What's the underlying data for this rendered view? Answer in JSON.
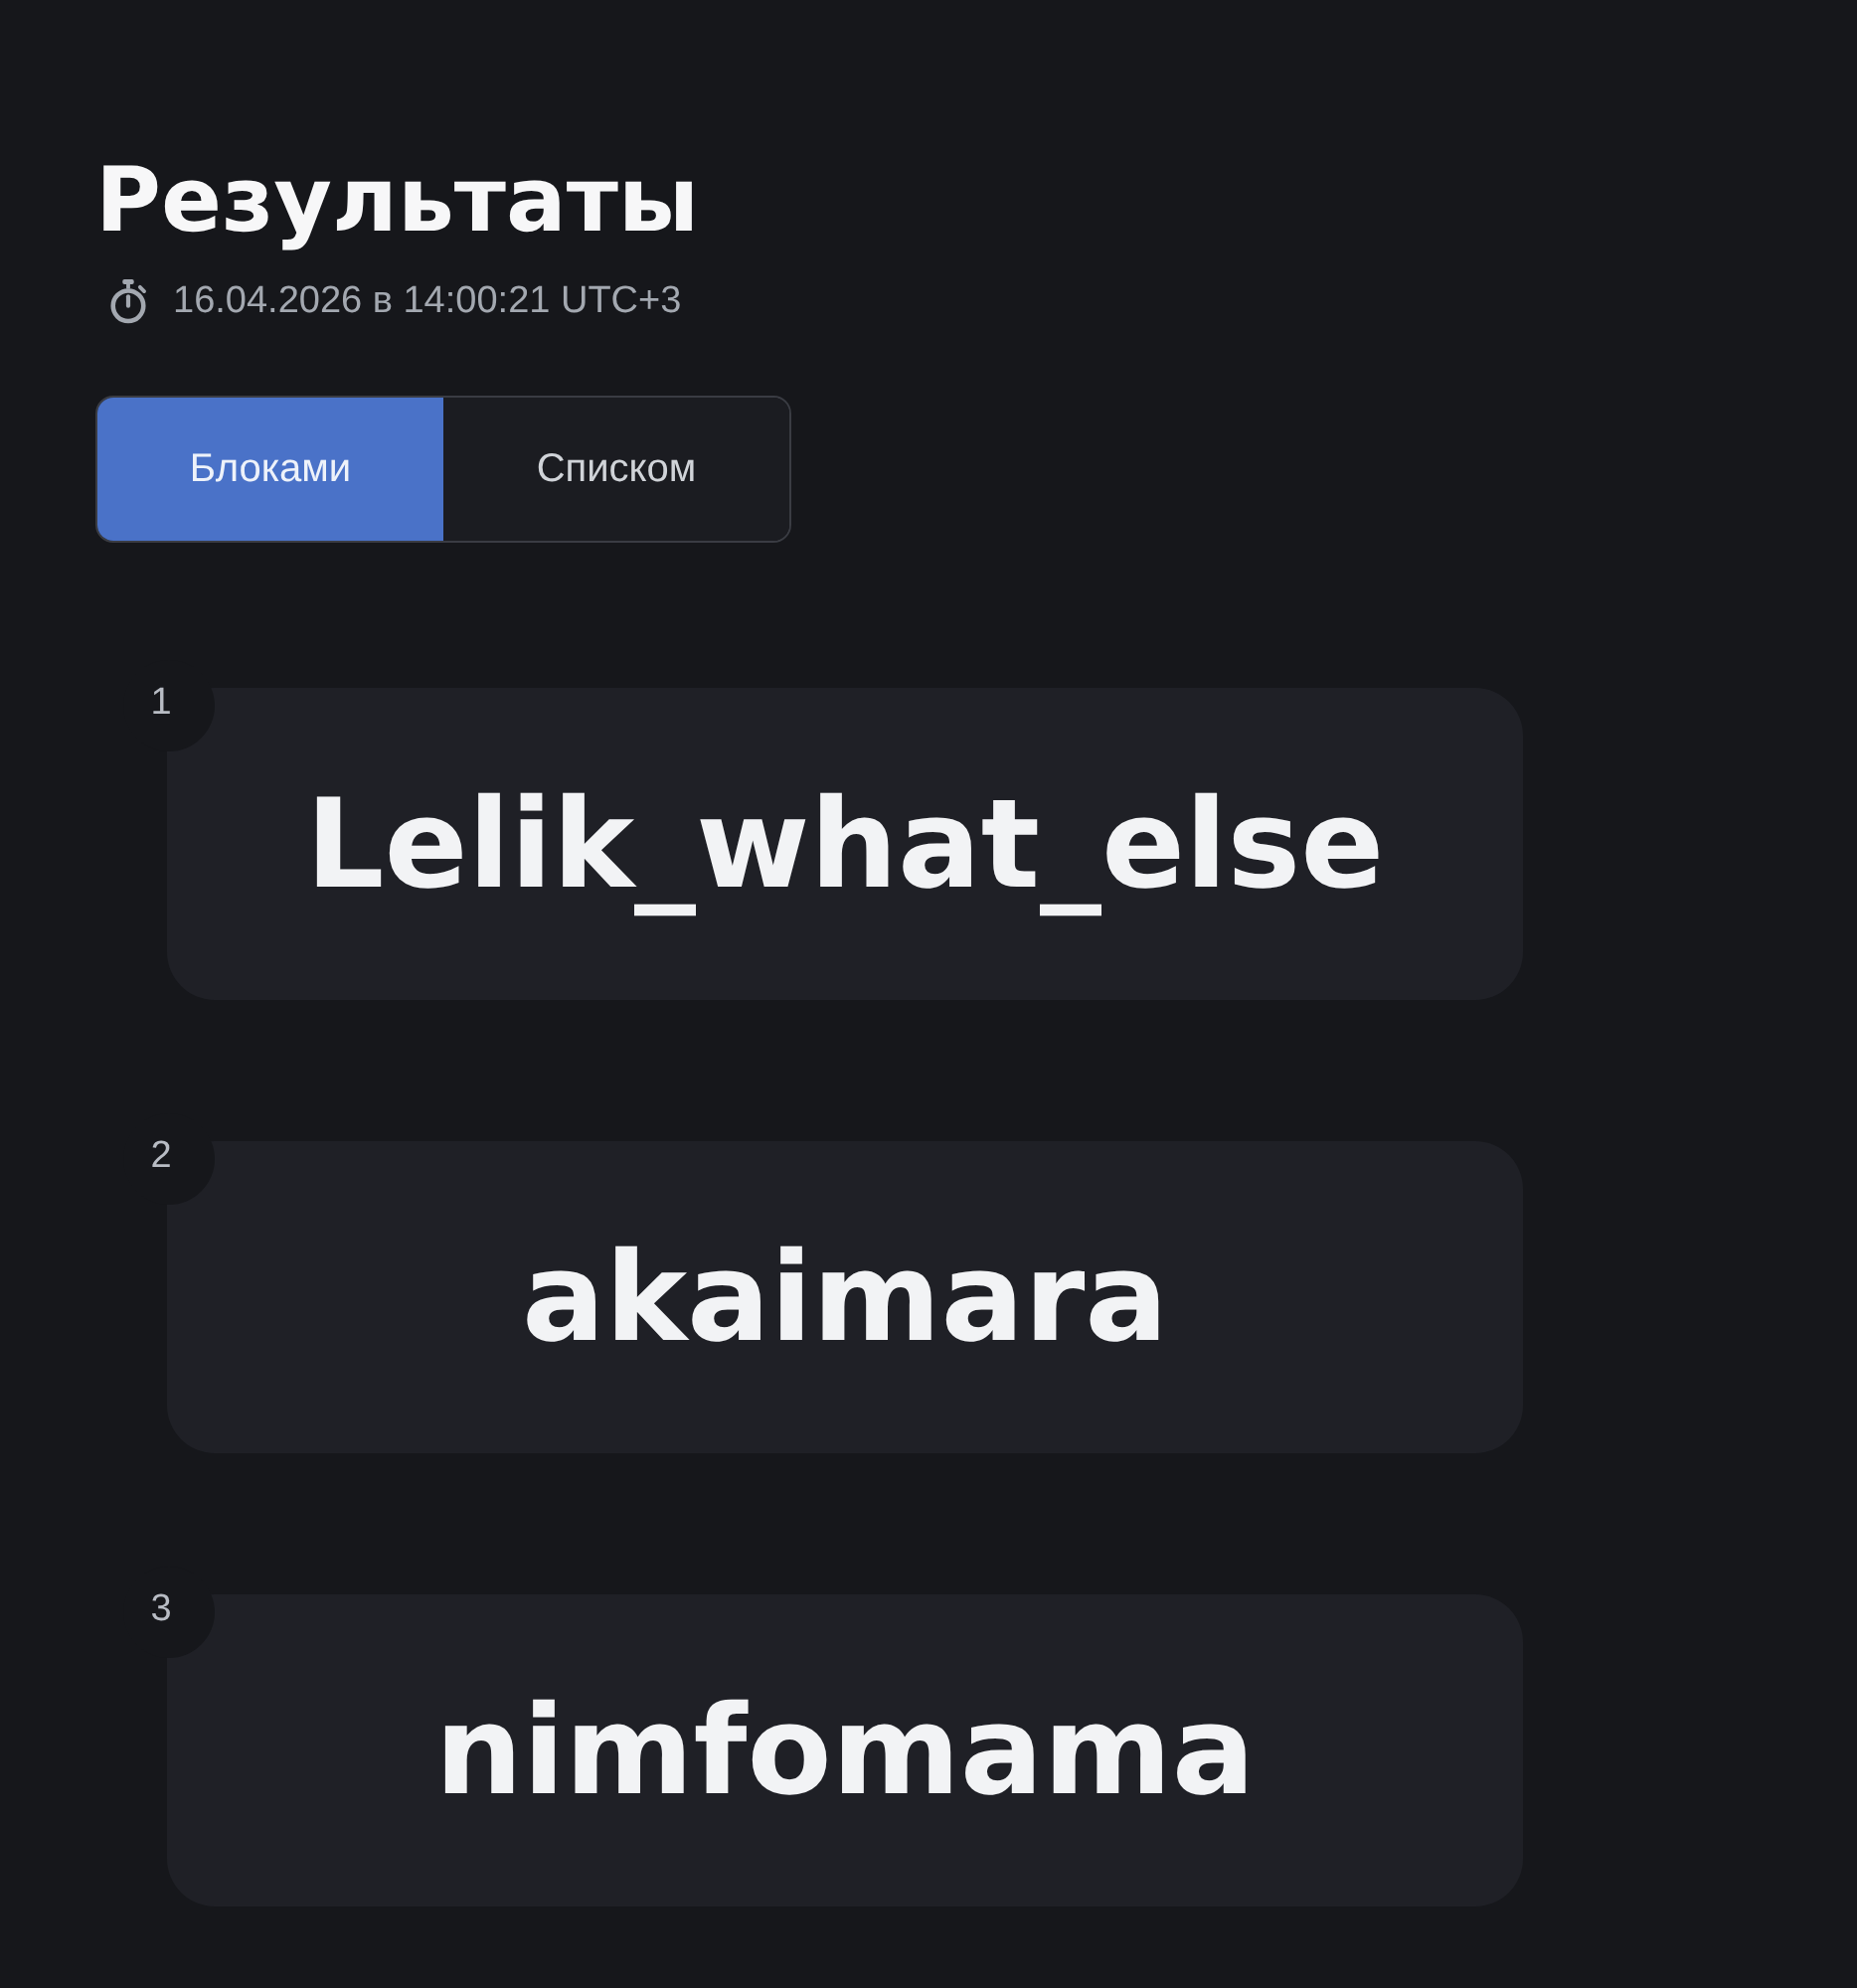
{
  "page": {
    "title": "Результаты",
    "timestamp": "16.04.2026 в 14:00:21 UTC+3"
  },
  "view_tabs": [
    {
      "label": "Блоками",
      "selected": true
    },
    {
      "label": "Списком",
      "selected": false
    }
  ],
  "results": [
    {
      "rank": "1",
      "name": "Lelik_what_else"
    },
    {
      "rank": "2",
      "name": "akaimara"
    },
    {
      "rank": "3",
      "name": "nimfomama"
    }
  ]
}
